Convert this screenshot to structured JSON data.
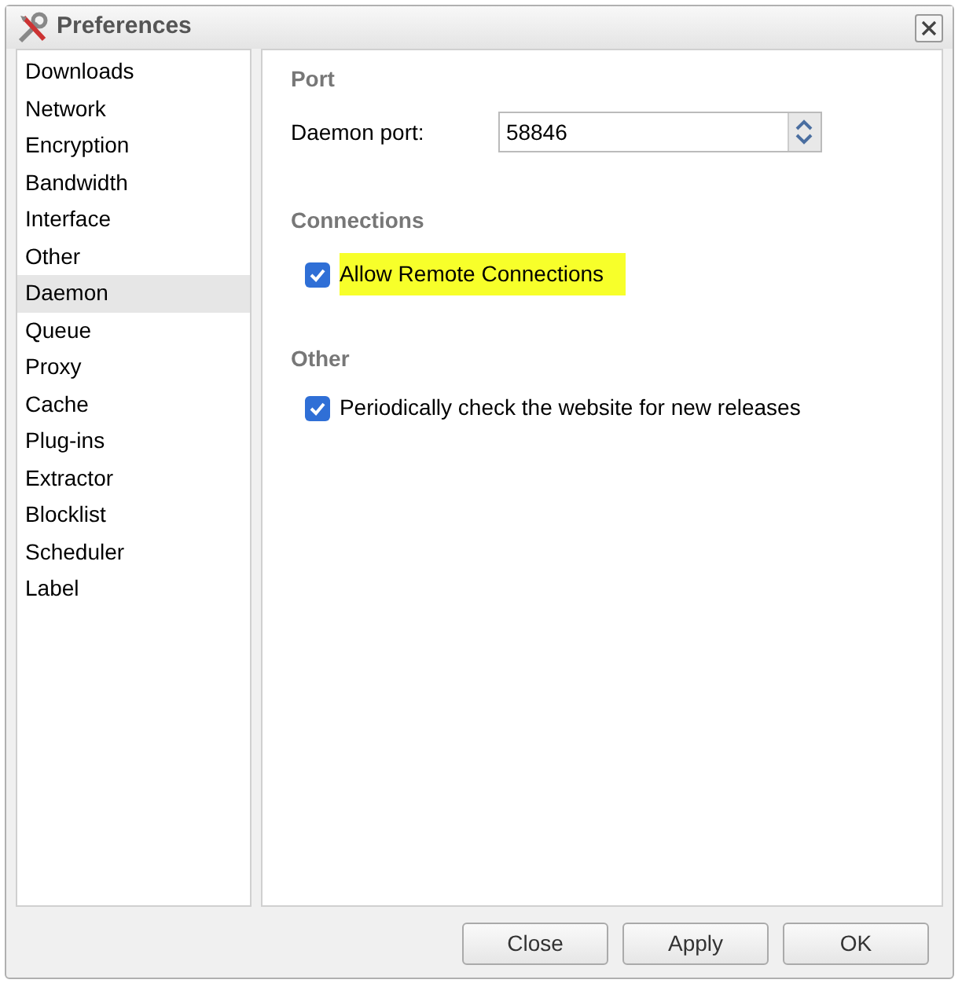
{
  "window": {
    "title": "Preferences"
  },
  "sidebar": {
    "items": [
      {
        "label": "Downloads",
        "selected": false
      },
      {
        "label": "Network",
        "selected": false
      },
      {
        "label": "Encryption",
        "selected": false
      },
      {
        "label": "Bandwidth",
        "selected": false
      },
      {
        "label": "Interface",
        "selected": false
      },
      {
        "label": "Other",
        "selected": false
      },
      {
        "label": "Daemon",
        "selected": true
      },
      {
        "label": "Queue",
        "selected": false
      },
      {
        "label": "Proxy",
        "selected": false
      },
      {
        "label": "Cache",
        "selected": false
      },
      {
        "label": "Plug-ins",
        "selected": false
      },
      {
        "label": "Extractor",
        "selected": false
      },
      {
        "label": "Blocklist",
        "selected": false
      },
      {
        "label": "Scheduler",
        "selected": false
      },
      {
        "label": "Label",
        "selected": false
      }
    ]
  },
  "sections": [
    {
      "title": "Port",
      "fields": [
        {
          "kind": "spinner",
          "label": "Daemon port:",
          "value": "58846"
        }
      ]
    },
    {
      "title": "Connections",
      "fields": [
        {
          "kind": "checkbox",
          "label": "Allow Remote Connections",
          "checked": true,
          "highlighted": true
        }
      ]
    },
    {
      "title": "Other",
      "fields": [
        {
          "kind": "checkbox",
          "label": "Periodically check the website for new releases",
          "checked": true,
          "highlighted": false
        }
      ]
    }
  ],
  "buttons": [
    "Close",
    "Apply",
    "OK"
  ]
}
